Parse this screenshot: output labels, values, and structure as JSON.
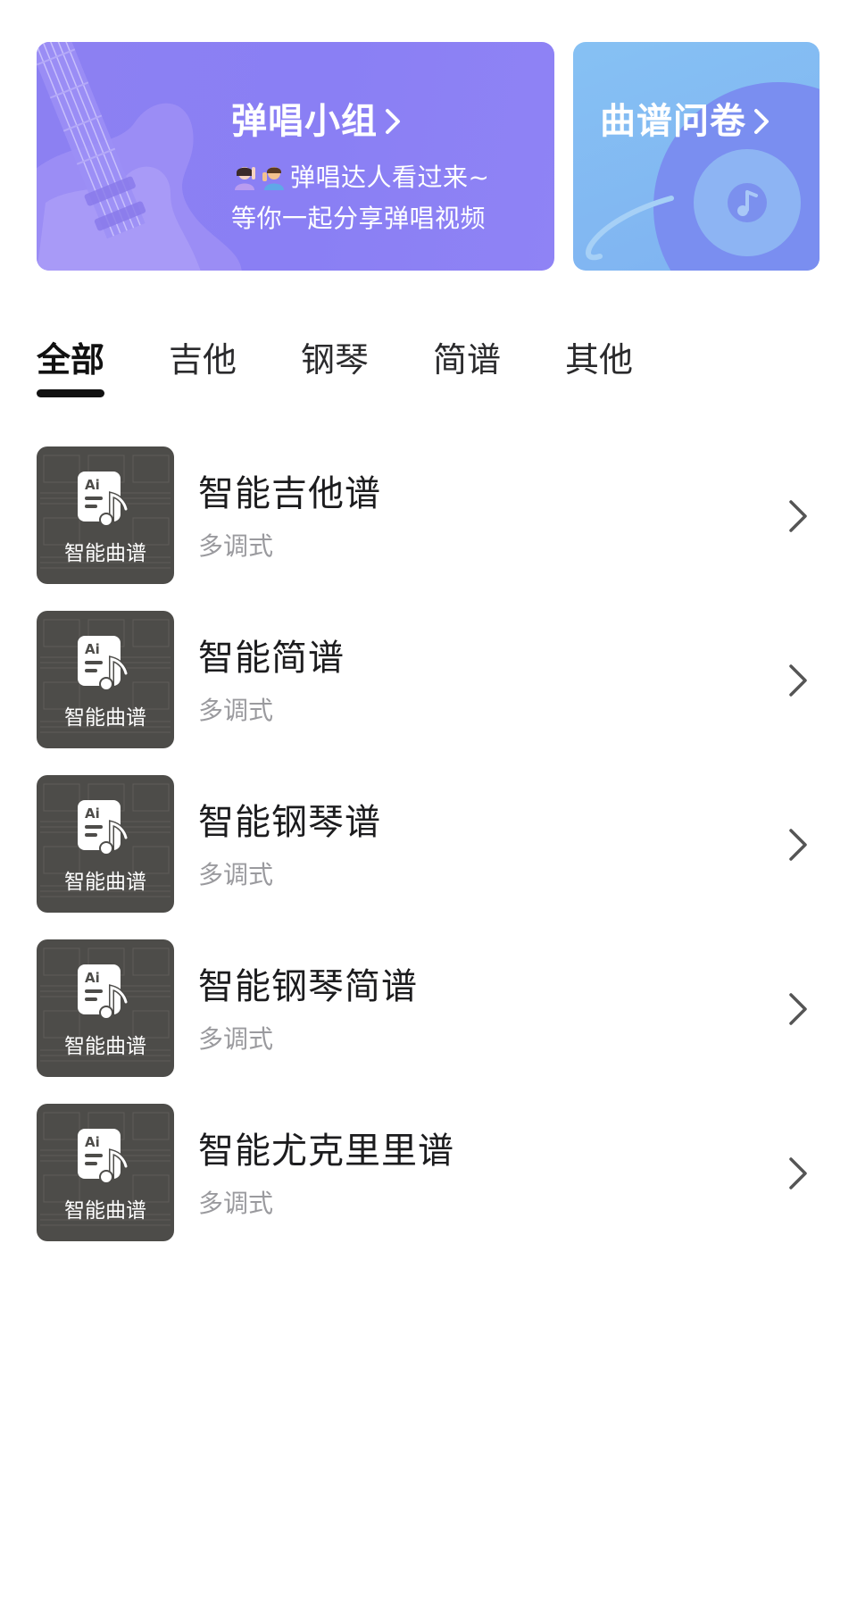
{
  "banners": {
    "group": {
      "title": "弹唱小组",
      "line1": "弹唱达人看过来~",
      "line2": "等你一起分享弹唱视频"
    },
    "survey": {
      "title": "曲谱问卷"
    }
  },
  "tabs": [
    {
      "label": "全部",
      "active": true
    },
    {
      "label": "吉他",
      "active": false
    },
    {
      "label": "钢琴",
      "active": false
    },
    {
      "label": "简谱",
      "active": false
    },
    {
      "label": "其他",
      "active": false
    }
  ],
  "items": [
    {
      "thumb_label": "智能曲谱",
      "title": "智能吉他谱",
      "subtitle": "多调式"
    },
    {
      "thumb_label": "智能曲谱",
      "title": "智能简谱",
      "subtitle": "多调式"
    },
    {
      "thumb_label": "智能曲谱",
      "title": "智能钢琴谱",
      "subtitle": "多调式"
    },
    {
      "thumb_label": "智能曲谱",
      "title": "智能钢琴简谱",
      "subtitle": "多调式"
    },
    {
      "thumb_label": "智能曲谱",
      "title": "智能尤克里里谱",
      "subtitle": "多调式"
    }
  ],
  "icons": {
    "ai_badge": "Ai",
    "thumb_icon": "ai-score-file-icon",
    "chevron": "chevron-right-icon",
    "guitar": "guitar-illustration",
    "planet": "music-planet-illustration"
  },
  "colors": {
    "banner_left": "#8a7ff4",
    "banner_right": "#82b8f2",
    "thumb_bg": "#4d4c49",
    "subtitle": "#9a9a9e",
    "tab_indicator": "#111111"
  }
}
